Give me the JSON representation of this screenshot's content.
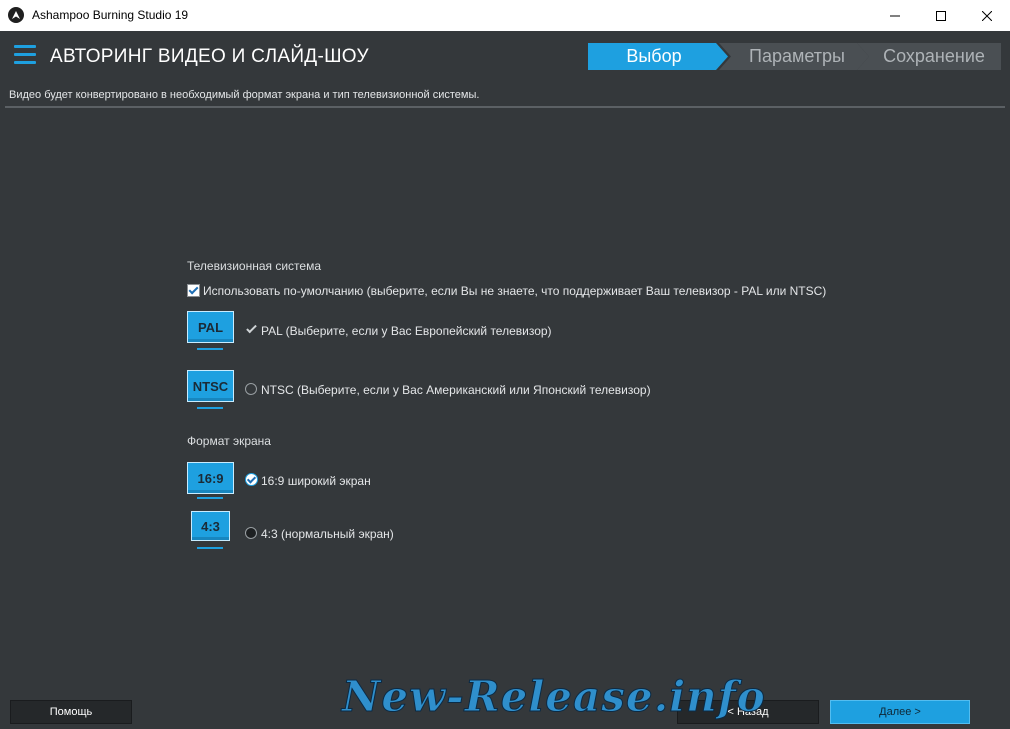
{
  "window": {
    "title": "Ashampoo Burning Studio 19"
  },
  "header": {
    "page_title": "АВТОРИНГ ВИДЕО И СЛАЙД-ШОУ",
    "steps": [
      {
        "label": "Выбор",
        "active": true
      },
      {
        "label": "Параметры",
        "active": false
      },
      {
        "label": "Сохранение",
        "active": false
      }
    ]
  },
  "subtitle": "Видео будет конвертировано в необходимый формат экрана и тип телевизионной системы.",
  "tv_system": {
    "label": "Телевизионная система",
    "use_default_label": "Использовать по-умолчанию (выберите, если Вы не знаете, что поддерживает Ваш телевизор - PAL или NTSC)",
    "use_default_checked": true,
    "options": [
      {
        "icon_text": "PAL",
        "label": "PAL (Выберите, если у Вас Европейский телевизор)",
        "selected": true
      },
      {
        "icon_text": "NTSC",
        "label": "NTSC (Выберите, если у Вас Американский или Японский телевизор)",
        "selected": false
      }
    ]
  },
  "screen_format": {
    "label": "Формат экрана",
    "options": [
      {
        "icon_text": "16:9",
        "label": "16:9 широкий экран",
        "selected": true
      },
      {
        "icon_text": "4:3",
        "label": "4:3 (нормальный экран)",
        "selected": false
      }
    ]
  },
  "footer": {
    "help_label": "Помощь",
    "back_label": "< Назад",
    "next_label": "Далее >"
  },
  "watermark": "New-Release.info",
  "colors": {
    "accent": "#1ea0e0",
    "background": "#34383b"
  }
}
